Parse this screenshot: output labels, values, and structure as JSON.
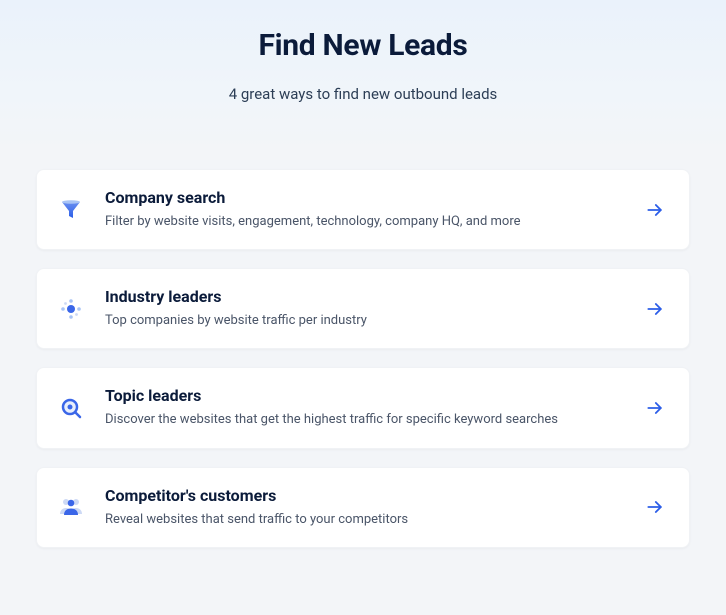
{
  "header": {
    "title": "Find New Leads",
    "subtitle": "4 great ways to find new outbound leads"
  },
  "cards": [
    {
      "icon": "funnel-icon",
      "title": "Company search",
      "description": "Filter by website visits, engagement, technology, company HQ, and more"
    },
    {
      "icon": "hub-icon",
      "title": "Industry leaders",
      "description": "Top companies by website traffic per industry"
    },
    {
      "icon": "magnify-icon",
      "title": "Topic leaders",
      "description": "Discover the websites that get the highest traffic for specific keyword searches"
    },
    {
      "icon": "people-icon",
      "title": "Competitor's customers",
      "description": "Reveal websites that send traffic to your competitors"
    }
  ],
  "colors": {
    "accent": "#2c5ee8",
    "iconLight": "#a9c4f5",
    "iconDark": "#3a66e8"
  }
}
